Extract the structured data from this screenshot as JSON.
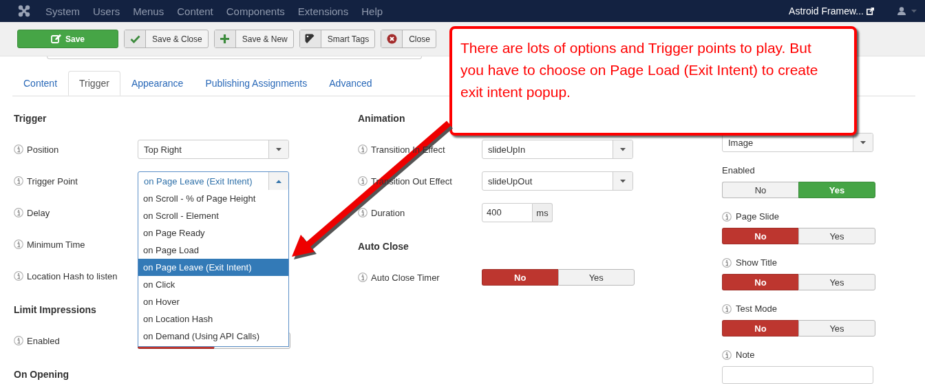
{
  "nav": {
    "menu": [
      "System",
      "Users",
      "Menus",
      "Content",
      "Components",
      "Extensions",
      "Help"
    ],
    "site_link": "Astroid Framew..."
  },
  "toolbar": [
    {
      "label": "Save",
      "kind": "primary"
    },
    {
      "label": "Save & Close",
      "kind": "check"
    },
    {
      "label": "Save & New",
      "kind": "plus"
    },
    {
      "label": "Smart Tags",
      "kind": "tag"
    },
    {
      "label": "Close",
      "kind": "close"
    }
  ],
  "tabs": [
    {
      "label": "Content",
      "selected": false
    },
    {
      "label": "Trigger",
      "selected": true
    },
    {
      "label": "Appearance",
      "selected": false
    },
    {
      "label": "Publishing Assignments",
      "selected": false
    },
    {
      "label": "Advanced",
      "selected": false
    }
  ],
  "columns": [
    {
      "kind": "inline",
      "sections": [
        {
          "heading": "Trigger",
          "fields": [
            {
              "label": "Position",
              "info": true,
              "kind": "select",
              "value": "Top Right"
            },
            {
              "label": "Trigger Point",
              "info": true,
              "kind": "select",
              "value": "on Page Leave (Exit Intent)",
              "expanded": true,
              "options": [
                {
                  "label": "on Scroll - % of Page Height",
                  "selected": false
                },
                {
                  "label": "on Scroll - Element",
                  "selected": false
                },
                {
                  "label": "on Page Ready",
                  "selected": false
                },
                {
                  "label": "on Page Load",
                  "selected": false
                },
                {
                  "label": "on Page Leave (Exit Intent)",
                  "selected": true
                },
                {
                  "label": "on Click",
                  "selected": false
                },
                {
                  "label": "on Hover",
                  "selected": false
                },
                {
                  "label": "on Location Hash",
                  "selected": false
                },
                {
                  "label": "on Demand (Using API Calls)",
                  "selected": false
                }
              ]
            },
            {
              "label": "Delay",
              "info": true
            },
            {
              "label": "Minimum Time",
              "info": true
            },
            {
              "label": "Location Hash to listen",
              "info": true
            }
          ]
        },
        {
          "heading": "Limit Impressions",
          "fields": [
            {
              "label": "Enabled",
              "info": true,
              "kind": "toggle",
              "options": [
                {
                  "selected": true
                },
                {
                  "selected": false
                }
              ]
            }
          ]
        },
        {
          "heading": "On Opening"
        }
      ]
    },
    {
      "kind": "inline",
      "sections": [
        {
          "heading": "Animation",
          "fields": [
            {
              "label": "Transition In Effect",
              "info": true,
              "kind": "select",
              "value": "slideUpIn"
            },
            {
              "label": "Transition Out Effect",
              "info": true,
              "kind": "select",
              "value": "slideUpOut"
            },
            {
              "label": "Duration",
              "info": true,
              "kind": "addon_input",
              "value": "400",
              "addon": "ms"
            }
          ]
        },
        {
          "heading": "Auto Close",
          "fields": [
            {
              "label": "Auto Close Timer",
              "info": true,
              "kind": "toggle",
              "options": [
                {
                  "label": "No",
                  "selected": true
                },
                {
                  "label": "Yes",
                  "selected": false
                }
              ]
            }
          ]
        }
      ]
    },
    {
      "kind": "stacked",
      "sections": [
        {
          "fields": [
            {
              "kind": "select",
              "value": "Image"
            },
            {
              "label": "Enabled",
              "info": false,
              "kind": "toggle",
              "options": [
                {
                  "label": "No",
                  "selected": false
                },
                {
                  "label": "Yes",
                  "selected": true
                }
              ]
            },
            {
              "label": "Page Slide",
              "info": true,
              "kind": "toggle",
              "options": [
                {
                  "label": "No",
                  "selected": true
                },
                {
                  "label": "Yes",
                  "selected": false
                }
              ]
            },
            {
              "label": "Show Title",
              "info": true,
              "kind": "toggle",
              "options": [
                {
                  "label": "No",
                  "selected": true
                },
                {
                  "label": "Yes",
                  "selected": false
                }
              ]
            },
            {
              "label": "Test Mode",
              "info": true,
              "kind": "toggle",
              "options": [
                {
                  "label": "No",
                  "selected": true
                },
                {
                  "label": "Yes",
                  "selected": false
                }
              ]
            },
            {
              "label": "Note",
              "info": true,
              "kind": "text"
            }
          ]
        }
      ]
    }
  ],
  "callout": {
    "text": "There are lots of options and Trigger points to play. But you have to choose on Page Load (Exit Intent) to create exit intent popup."
  }
}
